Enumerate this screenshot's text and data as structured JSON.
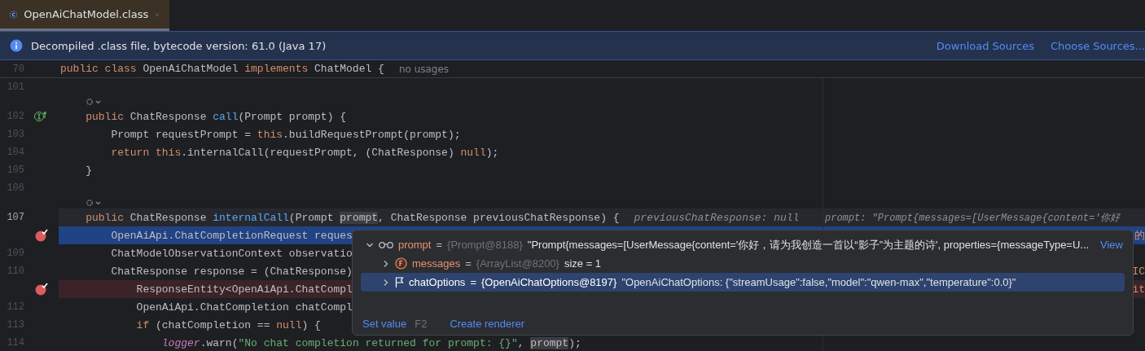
{
  "tabs": [
    {
      "label": "OpenAiChatModel.class",
      "selected": true
    }
  ],
  "banner": {
    "text": "Decompiled .class file, bytecode version: 61.0 (Java 17)",
    "links": [
      "Download Sources",
      "Choose Sources..."
    ]
  },
  "header_line": {
    "number": "70",
    "segments": [
      {
        "text": "public",
        "kind": "kw"
      },
      {
        "text": " class",
        "kind": "kw"
      },
      {
        "text": " OpenAiChatModel ",
        "kind": "plain"
      },
      {
        "text": "implements",
        "kind": "kw"
      },
      {
        "text": " ChatModel {",
        "kind": "plain"
      },
      {
        "text": "no usages",
        "kind": "usages"
      }
    ]
  },
  "lines": [
    {
      "kind": "code",
      "number": "101",
      "selected": false
    },
    {
      "kind": "inlay"
    },
    {
      "kind": "code",
      "number": "102",
      "overrides": true,
      "selected": false,
      "segments": [
        {
          "text": "    public",
          "kind": "kw"
        },
        {
          "text": " ChatResponse ",
          "kind": "plain"
        },
        {
          "text": "call",
          "kind": "fn"
        },
        {
          "text": "(Prompt prompt) {",
          "kind": "plain"
        }
      ]
    },
    {
      "kind": "code",
      "number": "103",
      "selected": false,
      "segments": [
        {
          "text": "        Prompt requestPrompt = ",
          "kind": "plain"
        },
        {
          "text": "this",
          "kind": "kw"
        },
        {
          "text": ".buildRequestPrompt(prompt);",
          "kind": "plain"
        }
      ]
    },
    {
      "kind": "code",
      "number": "104",
      "selected": false,
      "segments": [
        {
          "text": "        return",
          "kind": "kw"
        },
        {
          "text": " this",
          "kind": "kw"
        },
        {
          "text": ".internalCall(requestPrompt, (ChatResponse) ",
          "kind": "plain"
        },
        {
          "text": "null",
          "kind": "kw"
        },
        {
          "text": ");",
          "kind": "plain"
        }
      ]
    },
    {
      "kind": "code",
      "number": "105",
      "selected": false,
      "segments": [
        {
          "text": "    }",
          "kind": "plain"
        }
      ]
    },
    {
      "kind": "code",
      "number": "106",
      "selected": false
    },
    {
      "kind": "inlay"
    },
    {
      "kind": "code",
      "number": "107",
      "current": true,
      "selected": false,
      "segments": [
        {
          "text": "    public",
          "kind": "kw"
        },
        {
          "text": " ChatResponse ",
          "kind": "plain"
        },
        {
          "text": "internalCall",
          "kind": "fn"
        },
        {
          "text": "(Prompt ",
          "kind": "plain"
        },
        {
          "text": "prompt",
          "kind": "ref"
        },
        {
          "text": ", ChatResponse previousChatResponse) {",
          "kind": "plain"
        },
        {
          "text": "previousChatResponse: null",
          "kind": "hint"
        }
      ],
      "side": "prompt: \"Prompt{messages=[UserMessage{content='你好"
    },
    {
      "kind": "code",
      "breakpoint": true,
      "selected": true,
      "segments": [
        {
          "text": "        OpenAiApi.ChatCompletionRequest reques",
          "kind": "plain"
        }
      ],
      "edge": "的"
    },
    {
      "kind": "code",
      "number": "109",
      "selected": false,
      "segments": [
        {
          "text": "        ChatModelObservationContext observatio",
          "kind": "plain"
        }
      ]
    },
    {
      "kind": "code",
      "number": "110",
      "selected": false,
      "segments": [
        {
          "text": "        ChatResponse response = (ChatResponse)",
          "kind": "plain"
        }
      ],
      "edge": "IC"
    },
    {
      "kind": "code",
      "breakpoint": true,
      "selected": false,
      "segments": [
        {
          "text": "            ResponseEntity<OpenAiApi.ChatCompl",
          "kind": "plain"
        }
      ],
      "edge": "it"
    },
    {
      "kind": "code",
      "number": "112",
      "selected": false,
      "segments": [
        {
          "text": "            OpenAiApi.ChatCompletion chatCompl",
          "kind": "plain"
        }
      ]
    },
    {
      "kind": "code",
      "number": "113",
      "selected": false,
      "segments": [
        {
          "text": "            if",
          "kind": "kw"
        },
        {
          "text": " (chatCompletion == ",
          "kind": "plain"
        },
        {
          "text": "null",
          "kind": "kw"
        },
        {
          "text": ") {",
          "kind": "plain"
        }
      ]
    },
    {
      "kind": "code",
      "number": "114",
      "selected": false,
      "segments": [
        {
          "text": "                logger",
          "kind": "field"
        },
        {
          "text": ".warn(",
          "kind": "plain"
        },
        {
          "text": "\"No chat completion returned for prompt: {}\"",
          "kind": "str"
        },
        {
          "text": ", ",
          "kind": "plain"
        },
        {
          "text": "prompt",
          "kind": "ref"
        },
        {
          "text": ");",
          "kind": "plain"
        }
      ]
    }
  ],
  "popup": {
    "root": {
      "kind": "watch",
      "name": "prompt",
      "operator": "=",
      "type": "{Prompt@8188}",
      "value": "\"Prompt{messages=[UserMessage{content='你好，请为我创造一首以“影子”为主题的诗', properties={messageType=U...",
      "link": "View",
      "expanded": true,
      "selected": false,
      "children": [
        {
          "kind": "field",
          "name": "messages",
          "operator": "=",
          "type": "{ArrayList@8200}",
          "value": "size = 1",
          "expanded": false,
          "selected": false
        },
        {
          "kind": "flag",
          "name": "chatOptions",
          "operator": "=",
          "type": "{OpenAiChatOptions@8197}",
          "value": "\"OpenAiChatOptions: {\"streamUsage\":false,\"model\":\"qwen-max\",\"temperature\":0.0}\"",
          "expanded": false,
          "selected": true
        }
      ]
    },
    "actions": [
      {
        "label": "Set value",
        "shortcut": "F2"
      },
      {
        "label": "Create renderer"
      }
    ]
  }
}
